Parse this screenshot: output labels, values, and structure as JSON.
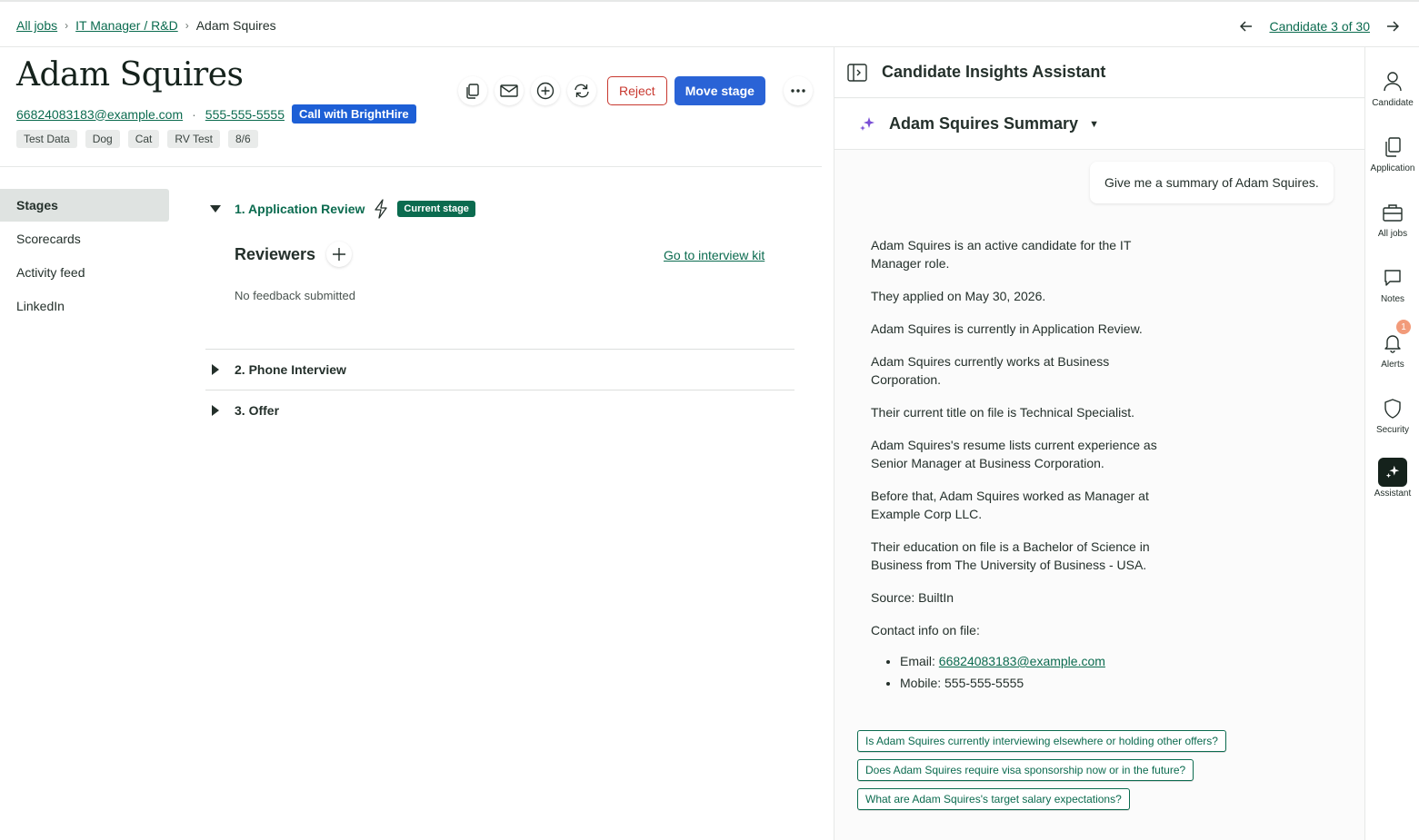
{
  "breadcrumb": {
    "all_jobs": "All jobs",
    "job": "IT Manager / R&D",
    "current": "Adam Squires",
    "candidate_pos": "Candidate 3 of 30"
  },
  "candidate": {
    "name": "Adam Squires",
    "email": "66824083183@example.com",
    "phone": "555-555-5555",
    "call_btn": "Call with BrightHire",
    "tags": [
      "Test Data",
      "Dog",
      "Cat",
      "RV Test",
      "8/6"
    ]
  },
  "actions": {
    "reject": "Reject",
    "move_stage": "Move stage"
  },
  "leftnav": {
    "items": [
      "Stages",
      "Scorecards",
      "Activity feed",
      "LinkedIn"
    ]
  },
  "stages": {
    "stage1": "1. Application Review",
    "current_badge": "Current stage",
    "reviewers": "Reviewers",
    "kit_link": "Go to interview kit",
    "no_feedback": "No feedback submitted",
    "stage2": "2. Phone Interview",
    "stage3": "3. Offer"
  },
  "assistant": {
    "title": "Candidate Insights Assistant",
    "summary_title": "Adam Squires Summary",
    "user_msg": "Give me a summary of Adam Squires.",
    "answer": {
      "p1": "Adam Squires is an active candidate for the IT Manager role.",
      "p2": "They applied on May 30, 2026.",
      "p3": "Adam Squires is currently in Application Review.",
      "p4": "Adam Squires currently works at Business Corporation.",
      "p5": "Their current title on file is Technical Specialist.",
      "p6": "Adam Squires's resume lists current experience as Senior Manager at Business Corporation.",
      "p7": "Before that, Adam Squires worked as Manager at Example Corp LLC.",
      "p8": "Their education on file is a Bachelor of Science in Business from The University of Business - USA.",
      "p9": "Source: BuiltIn",
      "p10": "Contact info on file:",
      "email_label": "Email: ",
      "email": "66824083183@example.com",
      "mobile": "Mobile: 555-555-5555"
    },
    "suggestions": [
      "Is Adam Squires currently interviewing elsewhere or holding other offers?",
      "Does Adam Squires require visa sponsorship now or in the future?",
      "What are Adam Squires's target salary expectations?"
    ]
  },
  "rail": {
    "candidate": "Candidate",
    "application": "Application",
    "all_jobs": "All jobs",
    "notes": "Notes",
    "alerts": "Alerts",
    "alerts_count": "1",
    "security": "Security",
    "assistant": "Assistant"
  },
  "colors": {
    "brand_green": "#0b6b4f",
    "primary_blue": "#2a63d6",
    "reject_red": "#c8382f",
    "brighthire_blue": "#1d5fd6",
    "alert_badge": "#f29b7a"
  }
}
